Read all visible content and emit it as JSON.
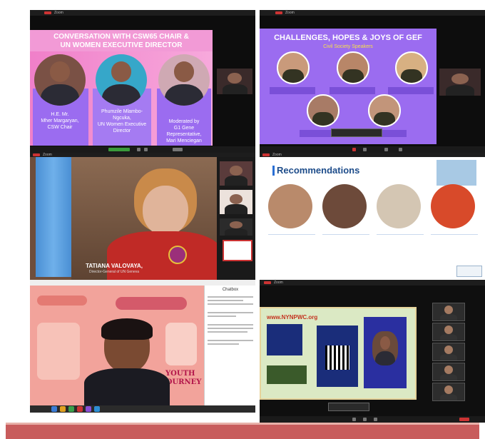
{
  "tile1": {
    "title_line1": "CONVERSATION WITH CSW65 CHAIR &",
    "title_line2": "UN WOMEN EXECUTIVE DIRECTOR",
    "speaker1": [
      "H.E. Mr.",
      "Mher Margaryan,",
      "CSW Chair"
    ],
    "speaker2": [
      "Phumzile Mlambo-",
      "Ngcuka,",
      "UN Women Executive",
      "Director"
    ],
    "speaker3": [
      "Moderated by",
      "G1 Gene",
      "Representative,",
      "Mari Menciegan"
    ]
  },
  "tile2": {
    "title": "CHALLENGES, HOPES & JOYS OF GEF",
    "subtitle": "Civil Society Speakers"
  },
  "tile3": {
    "nameplate": "TATIANA VALOVAYA,",
    "role": "Director-General of UN Geneva"
  },
  "tile4": {
    "heading": "Recommendations"
  },
  "tile5": {
    "panel_title": "Chatbox",
    "sign1": "YOUTH",
    "sign2": "JOURNEY"
  },
  "tile6": {
    "url": "www.NYNPWC.org"
  },
  "colors": {
    "purple": "#9b6cf0",
    "pink": "#f08ad0",
    "navy": "#1a2d7a",
    "banner": "#c85c5c",
    "rec_blue": "#1d4c8a"
  }
}
